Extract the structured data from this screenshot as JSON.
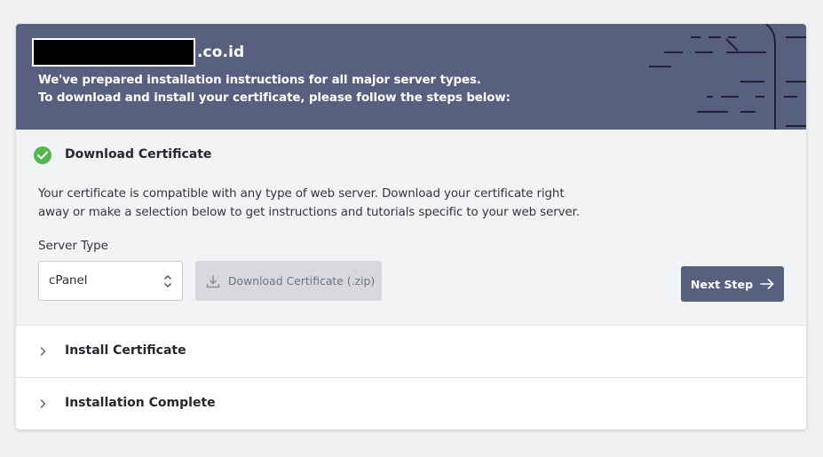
{
  "header": {
    "domain_suffix": ".co.id",
    "line1": "We've prepared installation instructions for all major server types.",
    "line2": "To download and install your certificate, please follow the steps below:"
  },
  "steps": [
    {
      "title": "Download Certificate",
      "status": "complete",
      "icon": "check-circle-icon",
      "description_line1": "Your certificate is compatible with any type of web server. Download your certificate right",
      "description_line2": "away or make a selection below to get instructions and tutorials specific to your web server.",
      "server_type_label": "Server Type",
      "server_type_value": "cPanel",
      "download_label": "Download Certificate (.zip)",
      "next_label": "Next Step"
    },
    {
      "title": "Install Certificate",
      "status": "collapsed",
      "icon": "chevron-right-icon"
    },
    {
      "title": "Installation Complete",
      "status": "collapsed",
      "icon": "chevron-right-icon"
    }
  ],
  "colors": {
    "header_bg": "#57607f",
    "success": "#55b64f",
    "primary_button": "#57607f",
    "disabled_button": "#d7d9de"
  }
}
